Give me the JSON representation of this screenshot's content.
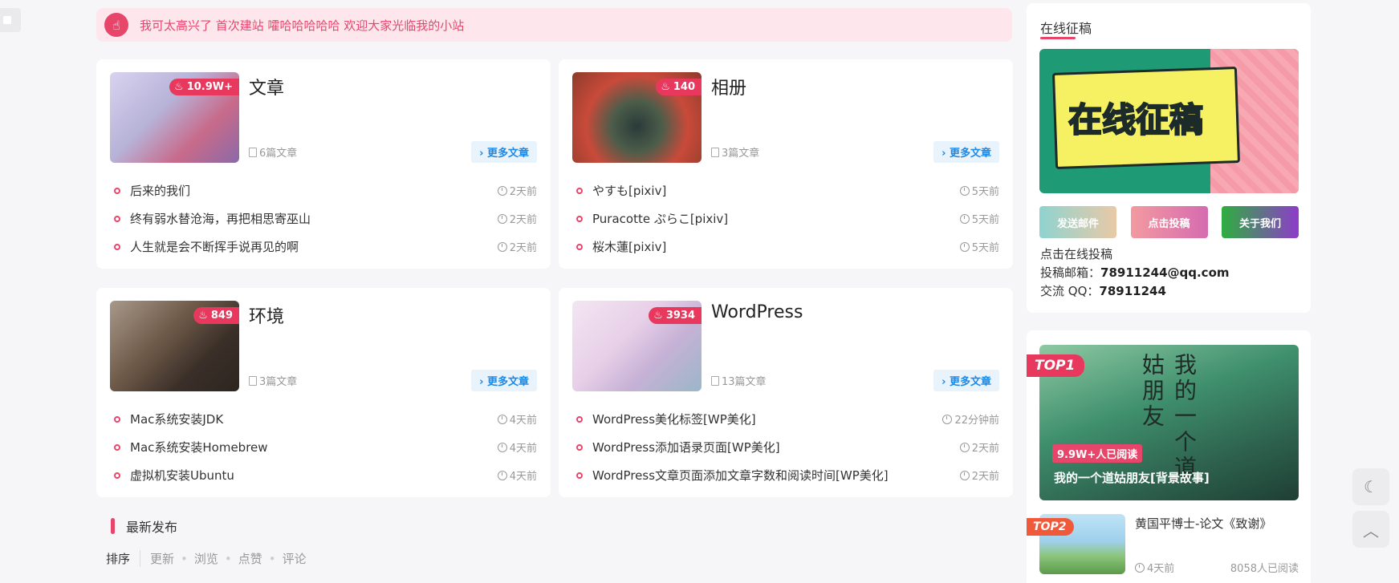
{
  "notice": {
    "icon": "hand-pointing-icon",
    "text": "我可太高兴了 首次建站 嚯哈哈哈哈哈 欢迎大家光临我的小站"
  },
  "categories": [
    {
      "name": "文章",
      "hot": "10.9W+",
      "count": "6篇文章",
      "more": "更多文章",
      "thumb_colors": [
        "#b7b3d8",
        "#c86a8a"
      ],
      "posts": [
        {
          "title": "后来的我们",
          "time": "2天前"
        },
        {
          "title": "终有弱水替沧海，再把相思寄巫山",
          "time": "2天前"
        },
        {
          "title": "人生就是会不断挥手说再见的啊",
          "time": "2天前"
        }
      ]
    },
    {
      "name": "相册",
      "hot": "140",
      "count": "3篇文章",
      "more": "更多文章",
      "thumb_colors": [
        "#c94a3a",
        "#2a3b3a"
      ],
      "posts": [
        {
          "title": "やすも[pixiv]",
          "time": "5天前"
        },
        {
          "title": "Puracotte ぷらこ[pixiv]",
          "time": "5天前"
        },
        {
          "title": "桜木蓮[pixiv]",
          "time": "5天前"
        }
      ]
    },
    {
      "name": "环境",
      "hot": "849",
      "count": "3篇文章",
      "more": "更多文章",
      "thumb_colors": [
        "#6f5a49",
        "#2e2520"
      ],
      "posts": [
        {
          "title": "Mac系统安装JDK",
          "time": "4天前"
        },
        {
          "title": "Mac系统安装Homebrew",
          "time": "4天前"
        },
        {
          "title": "虚拟机安装Ubuntu",
          "time": "4天前"
        }
      ]
    },
    {
      "name": "WordPress",
      "hot": "3934",
      "count": "13篇文章",
      "more": "更多文章",
      "thumb_colors": [
        "#e8d0e8",
        "#9ab6c8"
      ],
      "posts": [
        {
          "title": "WordPress美化标签[WP美化]",
          "time": "22分钟前"
        },
        {
          "title": "WordPress添加语录页面[WP美化]",
          "time": "2天前"
        },
        {
          "title": "WordPress文章页面添加文章字数和阅读时间[WP美化]",
          "time": "2天前"
        }
      ]
    }
  ],
  "latest": {
    "heading": "最新发布",
    "sort_label": "排序",
    "sort_options": [
      "更新",
      "浏览",
      "点赞",
      "评论"
    ]
  },
  "sidebar": {
    "submit_title": "在线征稿",
    "banner_text": "在线征稿",
    "buttons": [
      "发送邮件",
      "点击投稿",
      "关于我们"
    ],
    "info_line1": "点击在线投稿",
    "email_label": "投稿邮箱：",
    "email": "78911244@qq.com",
    "qq_label": "交流 QQ：",
    "qq": "78911244",
    "top1": {
      "rank": "TOP1",
      "reads": "9.9W+人已阅读",
      "title": "我的一个道姑朋友[背景故事]",
      "deco": "我的一个道姑朋友"
    },
    "top2": {
      "rank": "TOP2",
      "title": "黄国平博士-论文《致谢》",
      "time": "4天前",
      "reads": "8058人已阅读"
    }
  },
  "float_buttons": {
    "theme": "moon-icon",
    "top": "arrow-up-icon"
  }
}
